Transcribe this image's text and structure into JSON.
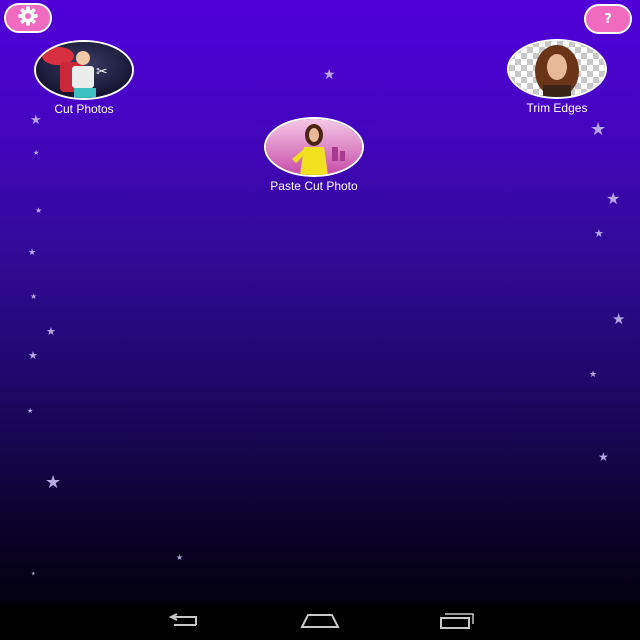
{
  "header": {
    "settings_icon": "gear-icon",
    "help_icon": "question-icon",
    "help_glyph": "?",
    "accent_color": "#f06bbf"
  },
  "features": [
    {
      "label": "Cut Photos",
      "icon": "cut-photos-thumbnail"
    },
    {
      "label": "Trim Edges",
      "icon": "trim-edges-thumbnail"
    },
    {
      "label": "Paste Cut Photo",
      "icon": "paste-cut-photo-thumbnail"
    }
  ],
  "navigation": {
    "back_icon": "back-arrow-icon",
    "home_icon": "home-icon",
    "recents_icon": "recent-apps-icon"
  },
  "colors": {
    "background_top": "#5000d8",
    "background_bottom": "#000000",
    "star": "#c8b8f4"
  }
}
